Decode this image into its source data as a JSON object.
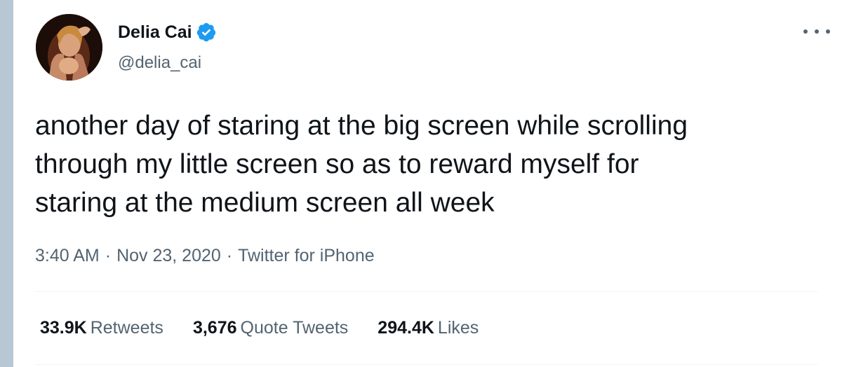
{
  "author": {
    "display_name": "Delia Cai",
    "handle": "@delia_cai",
    "verified_icon": "verified-badge-icon"
  },
  "menu": {
    "icon": "more-icon"
  },
  "tweet": {
    "lines": [
      "another day of staring at the big screen while scrolling",
      "through my little screen so as to reward myself for",
      "staring at the medium screen all week"
    ]
  },
  "meta": {
    "time": "3:40 AM",
    "separator": "·",
    "date": "Nov 23, 2020",
    "source": "Twitter for iPhone"
  },
  "stats": {
    "retweets": {
      "count": "33.9K",
      "label": "Retweets"
    },
    "quotes": {
      "count": "3,676",
      "label": "Quote Tweets"
    },
    "likes": {
      "count": "294.4K",
      "label": "Likes"
    }
  },
  "colors": {
    "verified": "#1d9bf0",
    "secondary_text": "#536471",
    "primary_text": "#0f1419",
    "left_strip": "#b7c7d3"
  }
}
